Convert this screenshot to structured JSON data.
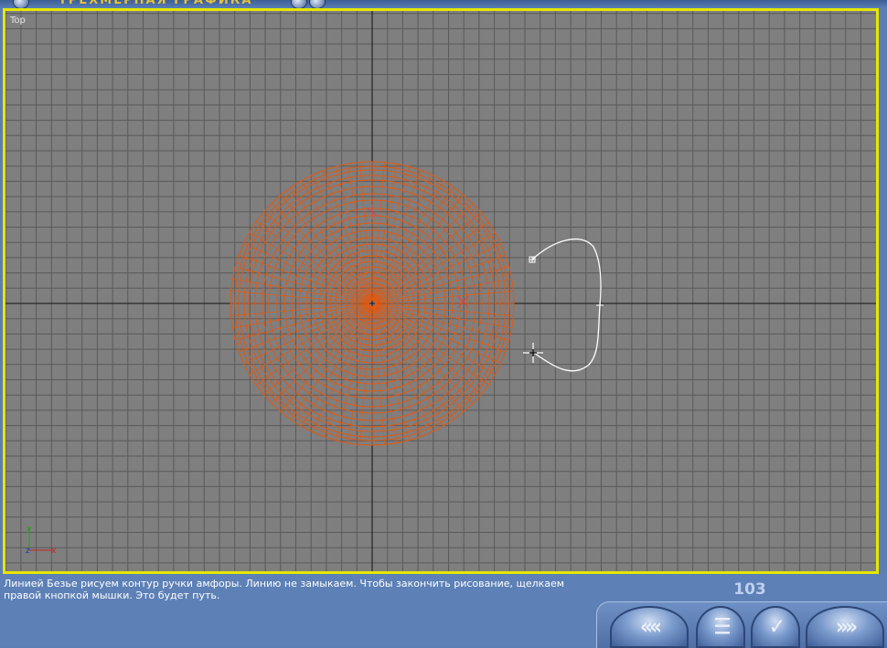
{
  "app": {
    "title": "ТРЕХМЕРНАЯ ГРАФИКА"
  },
  "viewport": {
    "label": "Top",
    "axis_x": "x",
    "axis_y": "y",
    "axis_z": "z",
    "grid_color": "#5a5a5a",
    "background_color": "#7f7f7f",
    "border_color": "#e6e600",
    "object_color": "#e05a14",
    "spline_color": "#ffffff"
  },
  "instruction": {
    "text": "Линией Безье рисуем контур ручки амфоры. Линию не замыкаем. Чтобы закончить рисование, щелкаем правой кнопкой мышки. Это будет путь."
  },
  "slide_number": "103",
  "nav": {
    "prev_icon": "fast-back-icon",
    "prev_label": "‹‹‹‹",
    "menu_icon": "list-icon",
    "menu_label": "☰",
    "check_icon": "check-icon",
    "check_label": "✓",
    "next_icon": "fast-forward-icon",
    "next_label": "››››"
  }
}
